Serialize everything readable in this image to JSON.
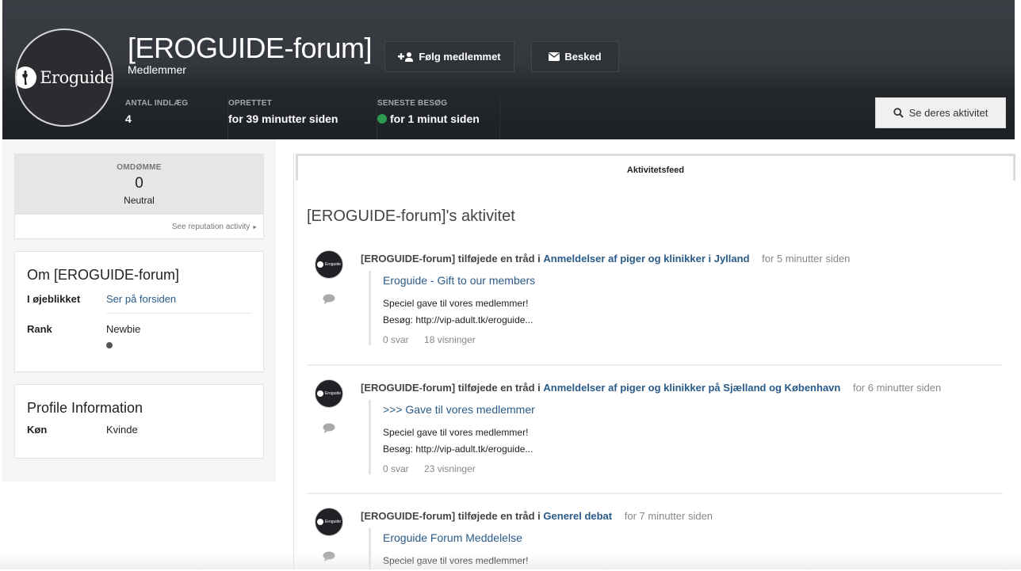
{
  "profile": {
    "name": "[EROGUIDE-forum]",
    "group": "Medlemmer",
    "avatar_text": "Eroguide",
    "follow_label": "Følg medlemmet",
    "message_label": "Besked",
    "activity_label": "Se deres aktivitet",
    "stats": [
      {
        "label": "ANTAL INDLÆG",
        "value": "4"
      },
      {
        "label": "OPRETTET",
        "value": "for 39 minutter siden"
      },
      {
        "label": "SENESTE BESØG",
        "value": "for 1 minut siden"
      }
    ]
  },
  "sidebar": {
    "reputation": {
      "label": "OMDØMME",
      "value": "0",
      "text": "Neutral",
      "link": "See reputation activity"
    },
    "about": {
      "title": "Om [EROGUIDE-forum]",
      "rows": [
        {
          "key": "I øjeblikket",
          "value": "Ser på forsiden"
        },
        {
          "key": "Rank",
          "value": "Newbie"
        }
      ]
    },
    "profile_info": {
      "title": "Profile Information",
      "rows": [
        {
          "key": "Køn",
          "value": "Kvinde"
        }
      ]
    }
  },
  "main": {
    "tab_label": "Aktivitetsfeed",
    "heading": "[EROGUIDE-forum]'s aktivitet",
    "entries": [
      {
        "who": "[EROGUIDE-forum] tilføjede en tråd i",
        "forum": "Anmeldelser af piger og klinikker i Jylland",
        "time": "for 5 minutter siden",
        "title": "Eroguide - Gift to our members",
        "line1": "Speciel gave til vores medlemmer!",
        "line2": "Besøg: http://vip-adult.tk/eroguide...",
        "replies": "0 svar",
        "views": "18 visninger"
      },
      {
        "who": "[EROGUIDE-forum] tilføjede en tråd i",
        "forum": "Anmeldelser af piger og klinikker på Sjælland og København",
        "time": "for 6 minutter siden",
        "title": ">>> Gave til vores medlemmer",
        "line1": "Speciel gave til vores medlemmer!",
        "line2": "Besøg: http://vip-adult.tk/eroguide...",
        "replies": "0 svar",
        "views": "23 visninger"
      },
      {
        "who": "[EROGUIDE-forum] tilføjede en tråd i",
        "forum": "Generel debat",
        "time": "for 7 minutter siden",
        "title": "Eroguide Forum Meddelelse",
        "line1": "Speciel gave til vores medlemmer!"
      }
    ]
  },
  "colors": {
    "link": "#2a5b88",
    "online": "#2c9a4d",
    "header_dark": "#1d2024"
  }
}
